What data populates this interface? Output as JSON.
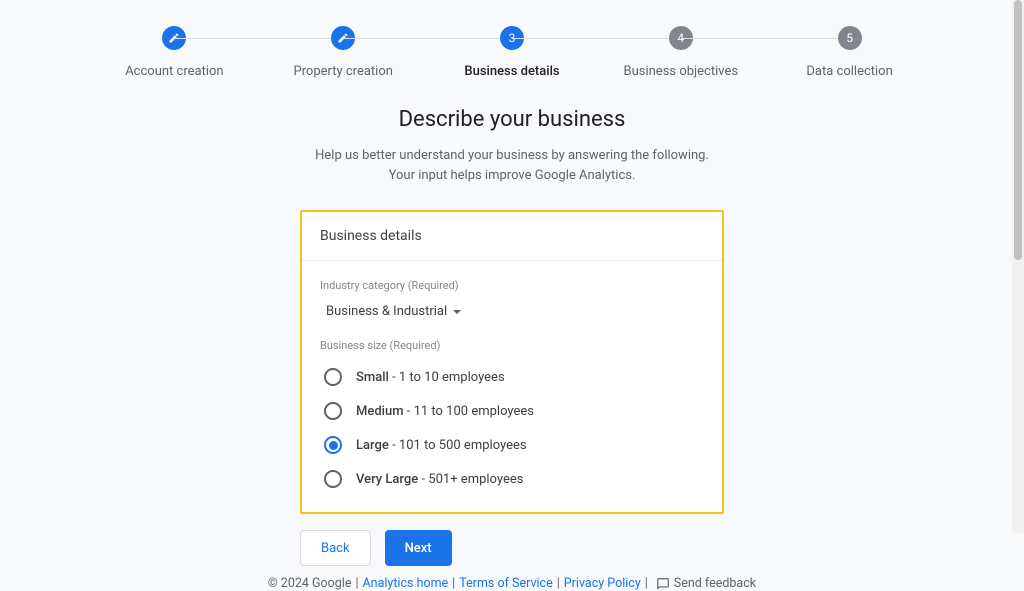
{
  "stepper": [
    {
      "label": "Account creation",
      "state": "done",
      "icon": "pencil"
    },
    {
      "label": "Property creation",
      "state": "done",
      "icon": "pencil"
    },
    {
      "label": "Business details",
      "state": "active",
      "icon": "3"
    },
    {
      "label": "Business objectives",
      "state": "todo",
      "icon": "4"
    },
    {
      "label": "Data collection",
      "state": "todo",
      "icon": "5"
    }
  ],
  "heading": "Describe your business",
  "subhead_line1": "Help us better understand your business by answering the following.",
  "subhead_line2": "Your input helps improve Google Analytics.",
  "card": {
    "title": "Business details",
    "industry_label": "Industry category (Required)",
    "industry_value": "Business & Industrial",
    "size_label": "Business size (Required)",
    "sizes": [
      {
        "bold": "Small",
        "rest": " - 1 to 10 employees",
        "selected": false
      },
      {
        "bold": "Medium",
        "rest": " - 11 to 100 employees",
        "selected": false
      },
      {
        "bold": "Large",
        "rest": " - 101 to 500 employees",
        "selected": true
      },
      {
        "bold": "Very Large",
        "rest": " - 501+ employees",
        "selected": false
      }
    ]
  },
  "buttons": {
    "back": "Back",
    "next": "Next"
  },
  "footer": {
    "copyright": "© 2024 Google",
    "links": [
      "Analytics home",
      "Terms of Service",
      "Privacy Policy"
    ],
    "feedback": "Send feedback"
  }
}
